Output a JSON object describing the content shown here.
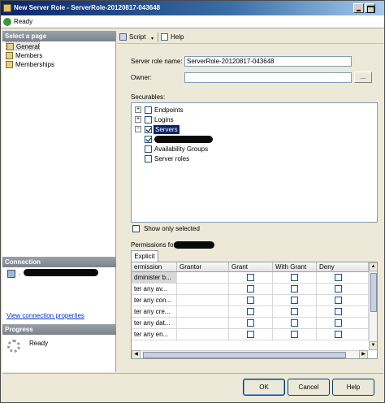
{
  "window": {
    "title": "New Server Role - ServerRole-20120817-043648",
    "status": "Ready"
  },
  "left": {
    "select_page_header": "Select a page",
    "pages": [
      {
        "label": "General"
      },
      {
        "label": "Members"
      },
      {
        "label": "Memberships"
      }
    ],
    "connection_header": "Connection",
    "connection_prefix": ".",
    "view_connection_link": "View connection properties",
    "progress_header": "Progress",
    "progress_status": "Ready"
  },
  "toolbar": {
    "script_label": "Script",
    "help_label": "Help"
  },
  "form": {
    "role_name_label": "Server role name:",
    "role_name_value": "ServerRole-20120817-043648",
    "owner_label": "Owner:",
    "owner_value": "",
    "browse_label": "...",
    "securables_label": "Securables:",
    "show_only_selected_label": "Show only selected",
    "permissions_for_label": "Permissions for"
  },
  "tree": [
    {
      "label": "Endpoints",
      "checked": false
    },
    {
      "label": "Logins",
      "checked": false
    },
    {
      "label": "Servers",
      "checked": true
    },
    {
      "label": "",
      "checked": true
    },
    {
      "label": "Availability Groups",
      "checked": false
    },
    {
      "label": "Server roles",
      "checked": false
    }
  ],
  "permissions": {
    "tab_label": "Explicit",
    "columns": [
      "ermission",
      "Grantor",
      "Grant",
      "With Grant",
      "Deny"
    ],
    "rows": [
      {
        "permission": "dminister b...",
        "grantor": ""
      },
      {
        "permission": "ter any av...",
        "grantor": ""
      },
      {
        "permission": "ter any con...",
        "grantor": ""
      },
      {
        "permission": "ter any cre...",
        "grantor": ""
      },
      {
        "permission": "ter any dat...",
        "grantor": ""
      },
      {
        "permission": "ter any en...",
        "grantor": ""
      }
    ]
  },
  "buttons": {
    "ok": "OK",
    "cancel": "Cancel",
    "help": "Help"
  }
}
